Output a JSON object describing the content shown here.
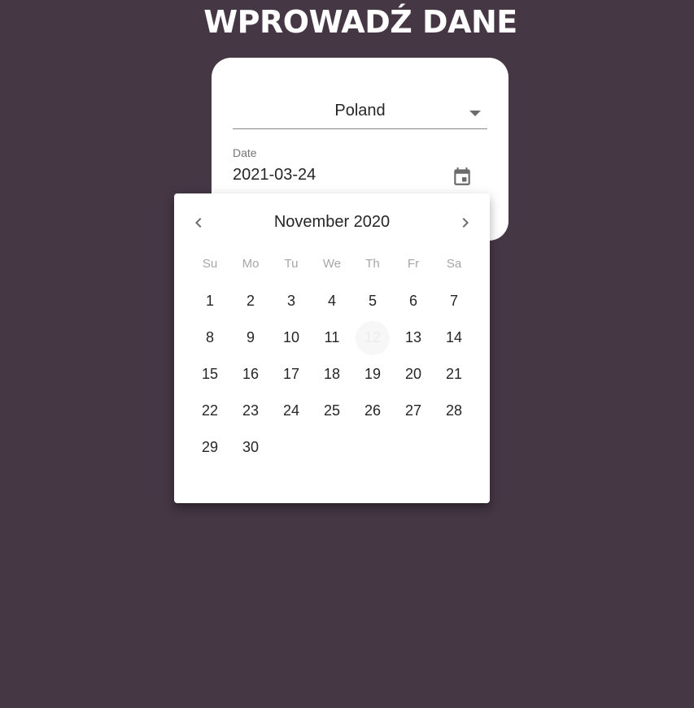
{
  "page": {
    "title": "WPROWADŹ DANE"
  },
  "form": {
    "country": {
      "selected": "Poland",
      "icon": "arrow-drop-down-icon"
    },
    "date": {
      "label": "Date",
      "value": "2021-03-24",
      "icon": "calendar-icon"
    }
  },
  "datepicker": {
    "month_label": "November 2020",
    "prev_icon": "chevron-left-icon",
    "next_icon": "chevron-right-icon",
    "weekdays": [
      "Su",
      "Mo",
      "Tu",
      "We",
      "Th",
      "Fr",
      "Sa"
    ],
    "first_weekday_offset": 0,
    "days": [
      "1",
      "2",
      "3",
      "4",
      "5",
      "6",
      "7",
      "8",
      "9",
      "10",
      "11",
      "12",
      "13",
      "14",
      "15",
      "16",
      "17",
      "18",
      "19",
      "20",
      "21",
      "22",
      "23",
      "24",
      "25",
      "26",
      "27",
      "28",
      "29",
      "30"
    ],
    "highlighted_day": "12"
  },
  "colors": {
    "background": "#453744",
    "card": "#ffffff",
    "text": "#262626",
    "muted": "#a6a6a6"
  }
}
